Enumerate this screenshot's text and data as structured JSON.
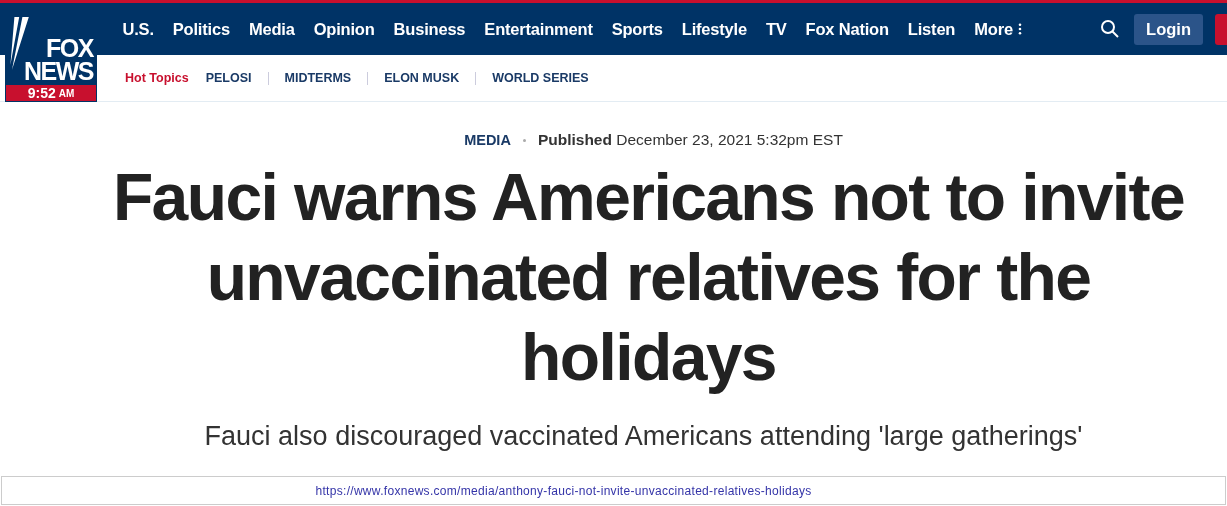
{
  "logo": {
    "line_1": "FOX",
    "line_2": "NEWS",
    "time": "9:52",
    "meridiem": "AM"
  },
  "nav": [
    "U.S.",
    "Politics",
    "Media",
    "Opinion",
    "Business",
    "Entertainment",
    "Sports",
    "Lifestyle",
    "TV",
    "Fox Nation",
    "Listen"
  ],
  "more": "More",
  "login": "Login",
  "hot_topics": {
    "label": "Hot Topics",
    "items": [
      "PELOSI",
      "MIDTERMS",
      "ELON MUSK",
      "WORLD SERIES"
    ]
  },
  "article": {
    "section": "MEDIA",
    "published_label": "Published",
    "date": "December 23, 2021 5:32pm EST",
    "headline": "Fauci warns Americans not to invite unvaccinated relatives for the holidays",
    "subheadline": "Fauci also discouraged vaccinated Americans attending 'large gatherings'"
  },
  "url": "https://www.foxnews.com/media/anthony-fauci-not-invite-unvaccinated-relatives-holidays"
}
